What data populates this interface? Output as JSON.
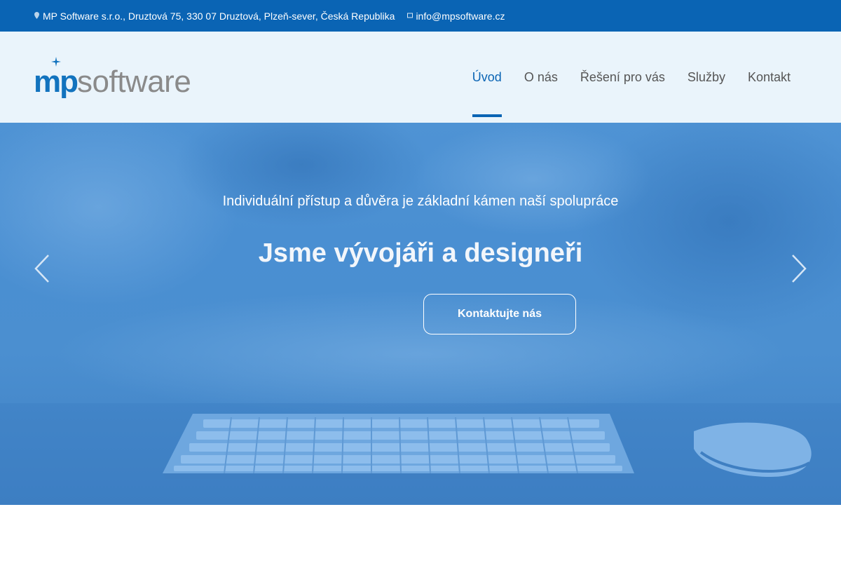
{
  "topbar": {
    "address_icon": "map-marker-icon",
    "address": "MP Software s.r.o., Druztová 75, 330 07 Druztová, Plzeň-sever, Česká Republika",
    "email_icon": "envelope-icon",
    "email": "info@mpsoftware.cz"
  },
  "header": {
    "logo_mp": "mp",
    "logo_software": "software",
    "nav": [
      {
        "label": "Úvod",
        "active": true
      },
      {
        "label": "O nás",
        "active": false
      },
      {
        "label": "Řešení pro vás",
        "active": false
      },
      {
        "label": "Služby",
        "active": false
      },
      {
        "label": "Kontakt",
        "active": false
      }
    ]
  },
  "hero": {
    "subtitle": "Individuální přístup a důvěra je základní kámen naší spolupráce",
    "title": "Jsme vývojáři a designeři",
    "button_label": "Kontaktujte nás",
    "prev_icon": "chevron-left-icon",
    "next_icon": "chevron-right-icon"
  },
  "colors": {
    "topbar": "#0a64b4",
    "header_bg": "#eaf4fb",
    "accent": "#0a64b4",
    "hero_overlay": "#4a8fd2"
  }
}
